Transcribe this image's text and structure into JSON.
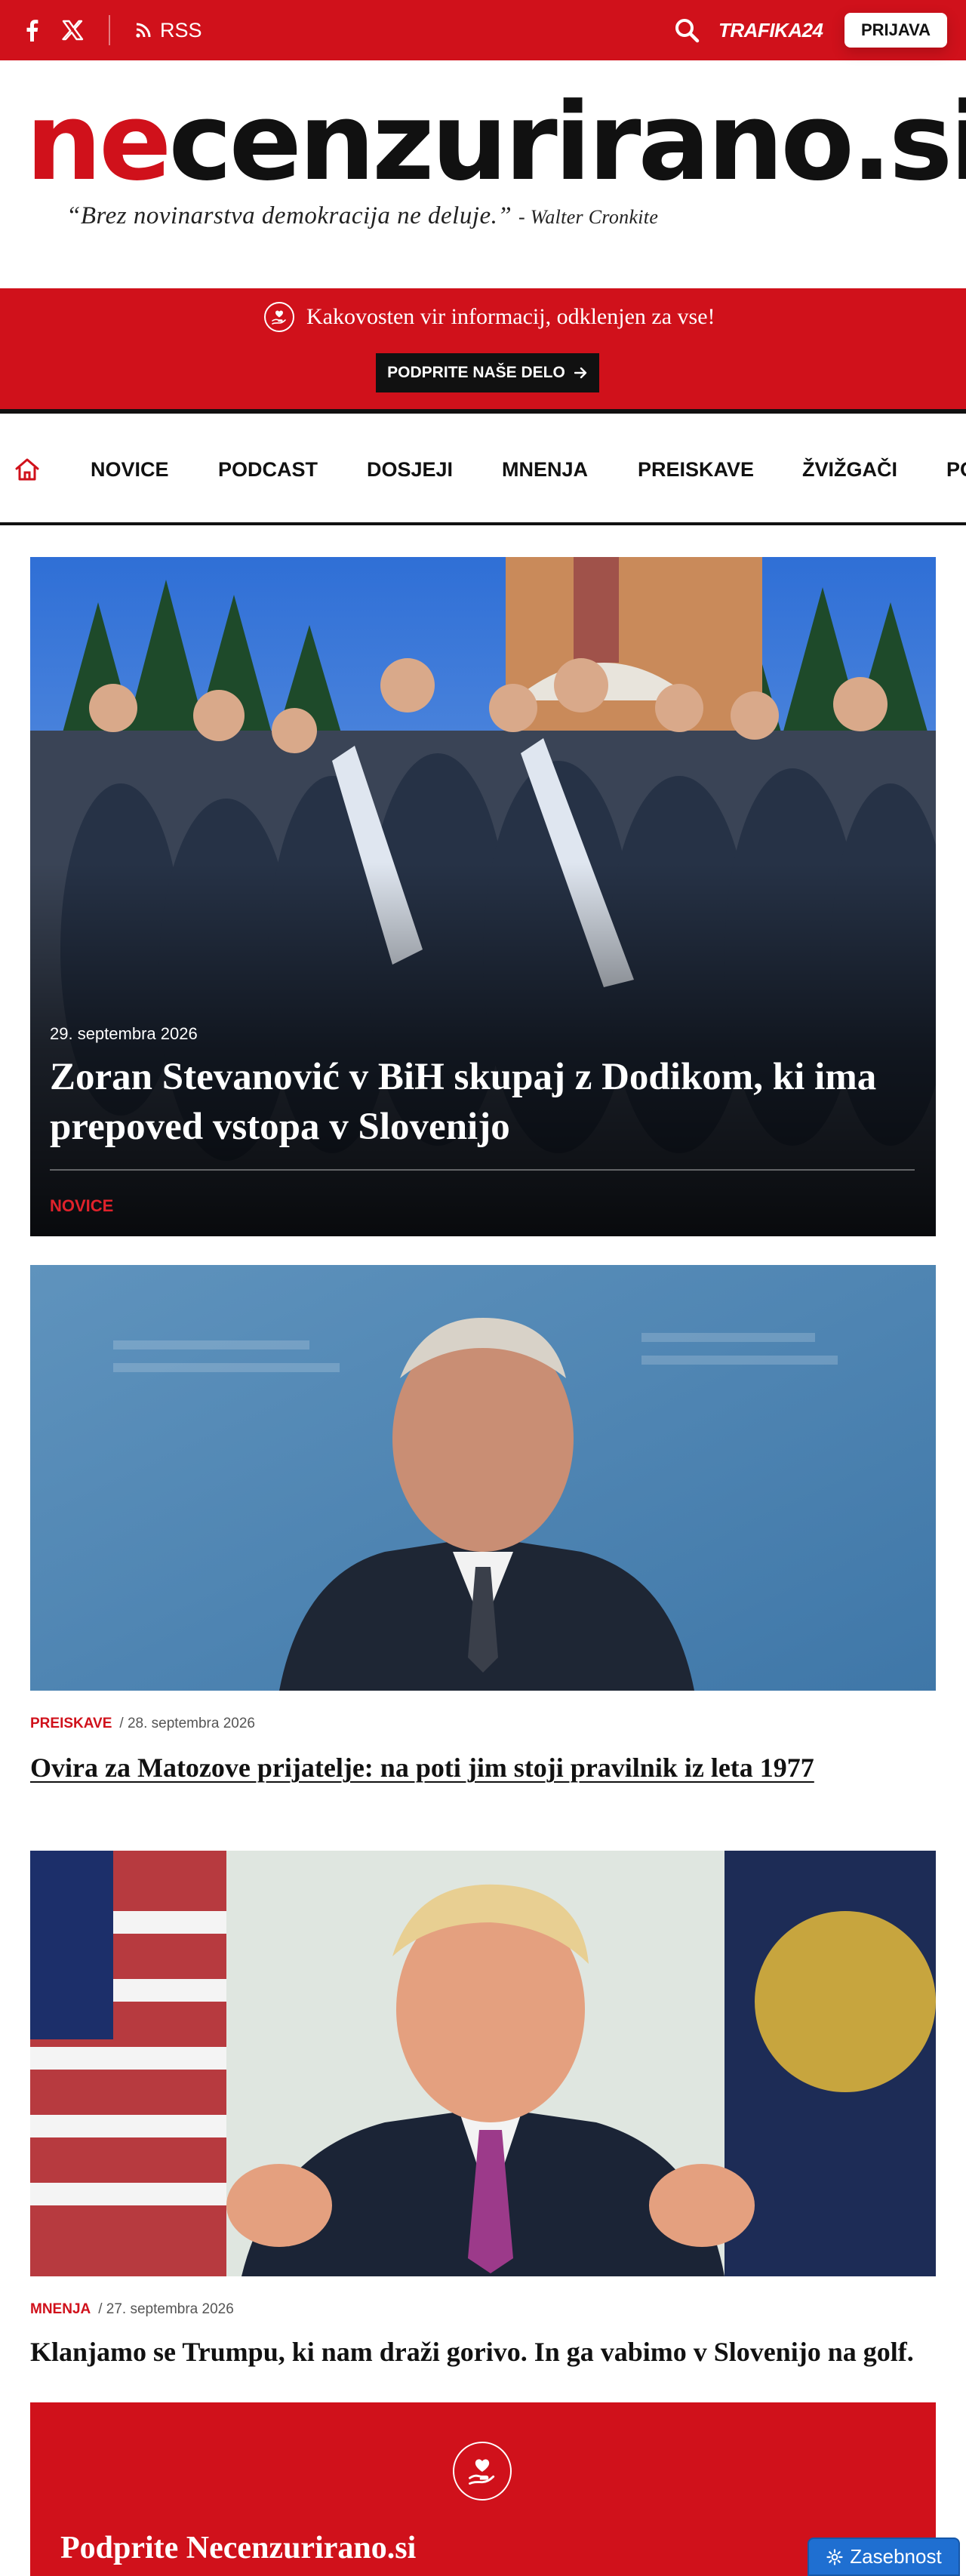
{
  "topbar": {
    "rss_label": "RSS",
    "trafika_label": "TRAFIKA24",
    "login_label": "PRIJAVA"
  },
  "logo": {
    "ne": "ne",
    "rest": "cenzurirano.si",
    "tagline": "“Brez novinarstva demokracija ne deluje.”",
    "tagline_author": "- Walter Cronkite"
  },
  "support_banner": {
    "message": "Kakovosten vir informacij, odklenjen za vse!",
    "button_label": "PODPRITE NAŠE DELO"
  },
  "nav": {
    "items": [
      "NOVICE",
      "PODCAST",
      "DOSJEJI",
      "MNENJA",
      "PREISKAVE",
      "ŽVIŽGAČI",
      "PO"
    ]
  },
  "hero": {
    "date": "29. septembra 2026",
    "title": "Zoran Stevanović v BiH skupaj z Dodikom, ki ima prepoved vstopa v Slovenijo",
    "category": "NOVICE"
  },
  "articles": [
    {
      "category": "PREISKAVE",
      "date": "/ 28. septembra 2026",
      "title": "Ovira za Matozove prijatelje: na poti jim stoji pravilnik iz leta 1977"
    },
    {
      "category": "MNENJA",
      "date": "/ 27. septembra 2026",
      "title": "Klanjamo se Trumpu, ki nam draži gorivo. In ga vabimo v Slovenijo na golf."
    }
  ],
  "support_box": {
    "title": "Podprite Necenzurirano.si"
  },
  "privacy_button": {
    "label": "Zasebnost"
  },
  "colors": {
    "brand_red": "#d0111b",
    "dark": "#111111",
    "privacy_blue": "#1f6fd1"
  },
  "icons": [
    "facebook-icon",
    "x-icon",
    "rss-icon",
    "search-icon",
    "heart-hand-icon",
    "arrow-right-icon",
    "home-icon",
    "gear-icon"
  ]
}
